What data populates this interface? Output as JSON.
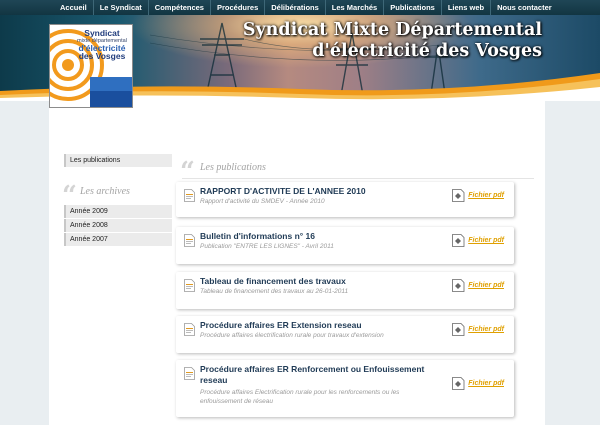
{
  "nav": {
    "items": [
      {
        "label": "Accueil",
        "name": "nav-item-accueil"
      },
      {
        "label": "Le Syndicat",
        "name": "nav-item-le-syndicat"
      },
      {
        "label": "Compétences",
        "name": "nav-item-competences"
      },
      {
        "label": "Procédures",
        "name": "nav-item-procedures"
      },
      {
        "label": "Délibérations",
        "name": "nav-item-deliberations"
      },
      {
        "label": "Les Marchés",
        "name": "nav-item-les-marches"
      },
      {
        "label": "Publications",
        "name": "nav-item-publications"
      },
      {
        "label": "Liens web",
        "name": "nav-item-liens-web"
      },
      {
        "label": "Nous contacter",
        "name": "nav-item-nous-contacter"
      }
    ]
  },
  "header": {
    "title_line1": "Syndicat Mixte Départemental",
    "title_line2": "d'électricité des Vosges"
  },
  "logo": {
    "line1": "Syndicat",
    "line2": "mixte départemental",
    "line3": "d'électricité",
    "line4": "des Vosges"
  },
  "sidebar": {
    "publications_link": "Les publications",
    "archives_quote": "“",
    "archives_title": "Les archives",
    "archives": [
      "Année 2009",
      "Année 2008",
      "Année 2007"
    ]
  },
  "main": {
    "quote": "“",
    "title": "Les publications",
    "pdf_label": "Fichier pdf",
    "publications": [
      {
        "title": "RAPPORT D'ACTIVITE DE L'ANNEE 2010",
        "subtitle": "Rapport d'activité du SMDEV - Année 2010"
      },
      {
        "title": "Bulletin d'informations n° 16",
        "subtitle": "Publication \"ENTRE LES LIGNES\" - Avril 2011"
      },
      {
        "title": "Tableau de financement des travaux",
        "subtitle": "Tableau de financement des travaux au 26-01-2011"
      },
      {
        "title": "Procédure affaires ER Extension reseau",
        "subtitle": "Procédure affaires électrification rurale pour travaux d'extension"
      },
      {
        "title_line1": "Procédure affaires ER Renforcement ou Enfouissement",
        "title_line2": "reseau",
        "subtitle_line1": "Procédure affaires Electrification rurale pour les renforcements ou les",
        "subtitle_line2": "enfouissement de réseau"
      }
    ]
  },
  "colors": {
    "nav_bg": "#1a3d4c",
    "link_title": "#1f3a55",
    "pdf_orange": "#e0a000",
    "section_grey": "#a3a3a3"
  },
  "icons": {
    "doc": "document-icon",
    "pdf": "pdf-file-icon"
  }
}
